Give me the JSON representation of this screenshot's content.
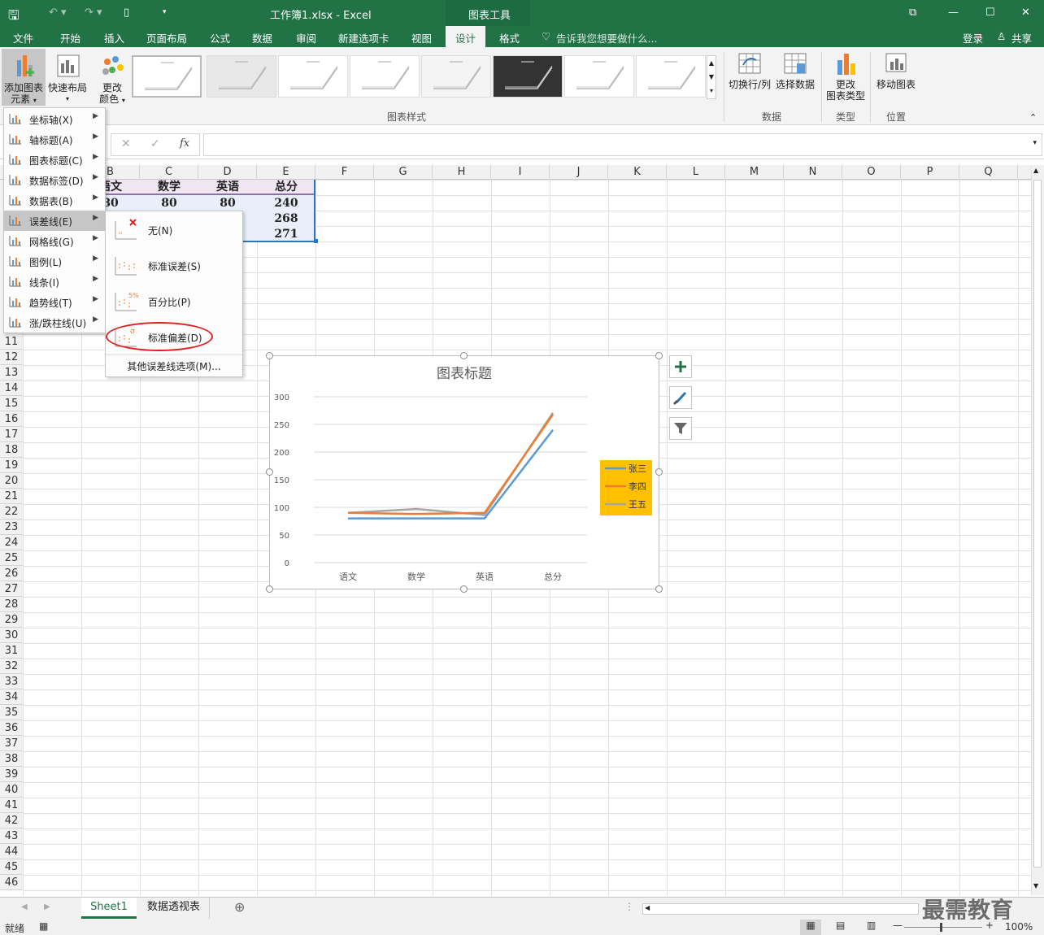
{
  "titlebar": {
    "title": "工作簿1.xlsx - Excel",
    "context": "图表工具"
  },
  "tabs": [
    "文件",
    "开始",
    "插入",
    "页面布局",
    "公式",
    "数据",
    "审阅",
    "新建选项卡",
    "视图",
    "设计",
    "格式"
  ],
  "tellme": "告诉我您想要做什么...",
  "login": "登录",
  "share": "共享",
  "ribbon": {
    "add_element_1": "添加图表",
    "add_element_2": "元素",
    "quick_layout": "快速布局",
    "change_color_1": "更改",
    "change_color_2": "颜色",
    "group_styles": "图表样式",
    "switch": "切换行/列",
    "select_data": "选择数据",
    "group_data": "数据",
    "change_type_1": "更改",
    "change_type_2": "图表类型",
    "group_type": "类型",
    "move_chart": "移动图表",
    "group_location": "位置"
  },
  "formula": {
    "cancel": "✕",
    "confirm": "✓",
    "fx": "fx"
  },
  "columns": [
    "B",
    "C",
    "D",
    "E",
    "F",
    "G",
    "H",
    "I",
    "J",
    "K",
    "L",
    "M",
    "N",
    "O",
    "P",
    "Q"
  ],
  "rows": [
    "11",
    "12",
    "13",
    "14",
    "15",
    "16",
    "17",
    "18",
    "19",
    "20",
    "21",
    "22",
    "23",
    "24",
    "25",
    "26",
    "27",
    "28",
    "29",
    "30",
    "31",
    "32",
    "33",
    "34",
    "35",
    "36",
    "37",
    "38",
    "39",
    "40",
    "41",
    "42",
    "43",
    "44",
    "45",
    "46"
  ],
  "table": {
    "header": [
      "语文",
      "数学",
      "英语",
      "总分"
    ],
    "r1": [
      "80",
      "80",
      "80",
      "240"
    ],
    "r2_total": "268",
    "r3_total": "271"
  },
  "menu": [
    {
      "label": "坐标轴(X)"
    },
    {
      "label": "轴标题(A)"
    },
    {
      "label": "图表标题(C)"
    },
    {
      "label": "数据标签(D)"
    },
    {
      "label": "数据表(B)"
    },
    {
      "label": "误差线(E)"
    },
    {
      "label": "网格线(G)"
    },
    {
      "label": "图例(L)"
    },
    {
      "label": "线条(I)"
    },
    {
      "label": "趋势线(T)"
    },
    {
      "label": "涨/跌柱线(U)"
    }
  ],
  "submenu": {
    "none": "无(N)",
    "std_error": "标准误差(S)",
    "percent": "百分比(P)",
    "std_dev": "标准偏差(D)",
    "more": "其他误差线选项(M)...",
    "percent_icon": "5%",
    "sigma_icon": "σ"
  },
  "chart_data": {
    "type": "line",
    "title": "图表标题",
    "categories": [
      "语文",
      "数学",
      "英语",
      "总分"
    ],
    "ylim": [
      0,
      300
    ],
    "yticks": [
      "300",
      "250",
      "200",
      "150",
      "100",
      "50",
      "0"
    ],
    "series": [
      {
        "name": "张三",
        "values": [
          80,
          80,
          80,
          240
        ],
        "color": "#5b9bd5"
      },
      {
        "name": "李四",
        "values": [
          90,
          88,
          90,
          268
        ],
        "color": "#ed7d31"
      },
      {
        "name": "王五",
        "values": [
          90,
          97,
          86,
          271
        ],
        "color": "#a5a5a5"
      }
    ],
    "legend": "right",
    "legend_bg": "#ffc000",
    "grid": true
  },
  "sheets": [
    "Sheet1",
    "数据透视表"
  ],
  "status": {
    "ready": "就绪",
    "zoom": "100%"
  },
  "watermark": "最需教育",
  "colors": {
    "excel_green": "#217346",
    "highlight_red": "#e02020"
  }
}
